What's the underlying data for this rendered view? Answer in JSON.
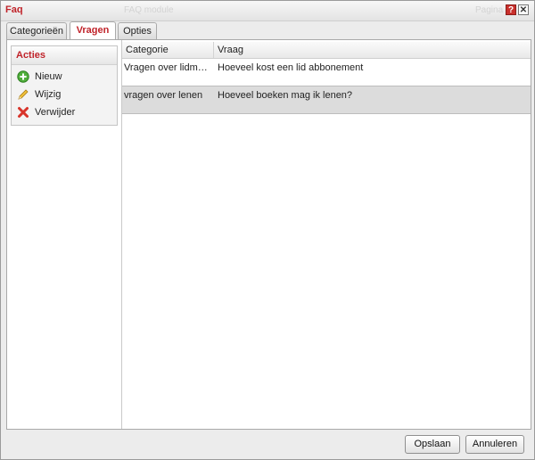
{
  "window": {
    "title": "Faq",
    "bg_center_text": "FAQ module",
    "bg_right_text": "Pagina",
    "help_label": "?",
    "close_label": "✕"
  },
  "tabs": [
    {
      "label": "Categorieën",
      "active": false
    },
    {
      "label": "Vragen",
      "active": true
    },
    {
      "label": "Opties",
      "active": false
    }
  ],
  "actions": {
    "title": "Acties",
    "items": [
      {
        "label": "Nieuw",
        "icon": "plus-circle-icon"
      },
      {
        "label": "Wijzig",
        "icon": "pencil-icon"
      },
      {
        "label": "Verwijder",
        "icon": "red-x-icon"
      }
    ]
  },
  "grid": {
    "columns": [
      "Categorie",
      "Vraag"
    ],
    "rows": [
      {
        "categorie": "Vragen over lidmaats…",
        "vraag": "Hoeveel kost een lid abbonement",
        "selected": false
      },
      {
        "categorie": "vragen over lenen",
        "vraag": "Hoeveel boeken mag ik lenen?",
        "selected": true
      }
    ]
  },
  "footer": {
    "save_label": "Opslaan",
    "cancel_label": "Annuleren"
  },
  "colors": {
    "accent": "#c0232a",
    "selected_row": "#dcdcdc"
  }
}
